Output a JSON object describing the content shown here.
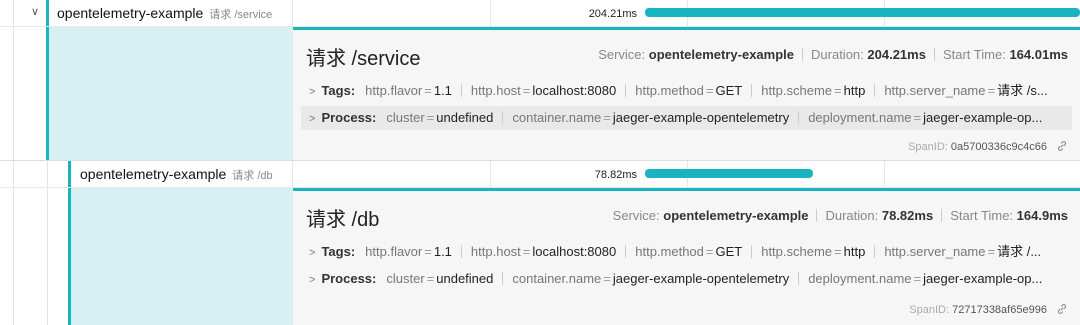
{
  "spans": [
    {
      "service": "opentelemetry-example",
      "operation": "请求 /service",
      "duration_label": "204.21ms",
      "bar_fraction": 1.0,
      "detail": {
        "title": "请求 /service",
        "service_label": "Service:",
        "service_value": "opentelemetry-example",
        "duration_label": "Duration:",
        "duration_value": "204.21ms",
        "start_label": "Start Time:",
        "start_value": "164.01ms",
        "tags_label": "Tags:",
        "tags": [
          {
            "k": "http.flavor",
            "v": "1.1"
          },
          {
            "k": "http.host",
            "v": "localhost:8080"
          },
          {
            "k": "http.method",
            "v": "GET"
          },
          {
            "k": "http.scheme",
            "v": "http"
          },
          {
            "k": "http.server_name",
            "v": "请求 /s..."
          }
        ],
        "process_label": "Process:",
        "process": [
          {
            "k": "cluster",
            "v": "undefined"
          },
          {
            "k": "container.name",
            "v": "jaeger-example-opentelemetry"
          },
          {
            "k": "deployment.name",
            "v": "jaeger-example-op..."
          }
        ],
        "spanid_label": "SpanID:",
        "spanid_value": "0a5700336c9c4c66"
      }
    },
    {
      "service": "opentelemetry-example",
      "operation": "请求 /db",
      "duration_label": "78.82ms",
      "bar_fraction": 0.386,
      "detail": {
        "title": "请求 /db",
        "service_label": "Service:",
        "service_value": "opentelemetry-example",
        "duration_label": "Duration:",
        "duration_value": "78.82ms",
        "start_label": "Start Time:",
        "start_value": "164.9ms",
        "tags_label": "Tags:",
        "tags": [
          {
            "k": "http.flavor",
            "v": "1.1"
          },
          {
            "k": "http.host",
            "v": "localhost:8080"
          },
          {
            "k": "http.method",
            "v": "GET"
          },
          {
            "k": "http.scheme",
            "v": "http"
          },
          {
            "k": "http.server_name",
            "v": "请求 /..."
          }
        ],
        "process_label": "Process:",
        "process": [
          {
            "k": "cluster",
            "v": "undefined"
          },
          {
            "k": "container.name",
            "v": "jaeger-example-opentelemetry"
          },
          {
            "k": "deployment.name",
            "v": "jaeger-example-op..."
          }
        ],
        "spanid_label": "SpanID:",
        "spanid_value": "72717338af65e996"
      }
    }
  ],
  "colors": {
    "accent": "#18b5c1",
    "detail_fill": "#d6f0f3"
  },
  "icons": {
    "collapse": "chevron-down-icon",
    "expand": "chevron-right-icon",
    "link": "link-icon"
  }
}
